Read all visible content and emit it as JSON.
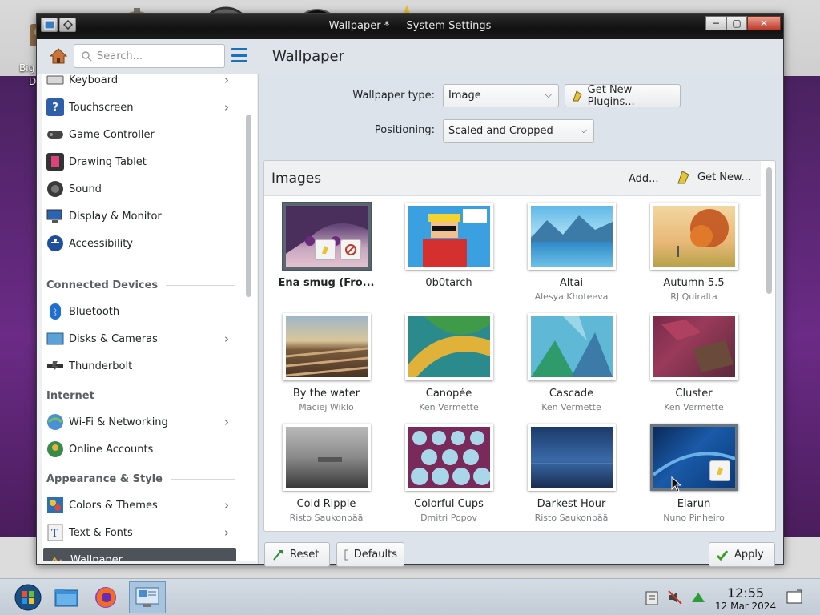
{
  "desktop": {
    "icon_label_1": "Big",
    "icon_label_2": "D"
  },
  "window": {
    "title": "Wallpaper * — System Settings",
    "controls": {
      "minimize": "−",
      "maximize": "▢",
      "close": "✕"
    }
  },
  "toolbar": {
    "search_placeholder": "Search...",
    "page_title": "Wallpaper"
  },
  "sidebar": {
    "items": [
      {
        "label": "Keyboard",
        "icon": "keyboard-icon",
        "chevron": true
      },
      {
        "label": "Touchscreen",
        "icon": "touchscreen-icon",
        "chevron": true
      },
      {
        "label": "Game Controller",
        "icon": "game-controller-icon",
        "chevron": false
      },
      {
        "label": "Drawing Tablet",
        "icon": "drawing-tablet-icon",
        "chevron": false
      },
      {
        "label": "Sound",
        "icon": "sound-icon",
        "chevron": false
      },
      {
        "label": "Display & Monitor",
        "icon": "display-icon",
        "chevron": false
      },
      {
        "label": "Accessibility",
        "icon": "accessibility-icon",
        "chevron": false
      }
    ],
    "section_connected": "Connected Devices",
    "connected_items": [
      {
        "label": "Bluetooth",
        "icon": "bluetooth-icon",
        "chevron": false
      },
      {
        "label": "Disks & Cameras",
        "icon": "disks-icon",
        "chevron": true
      },
      {
        "label": "Thunderbolt",
        "icon": "thunderbolt-icon",
        "chevron": false
      }
    ],
    "section_internet": "Internet",
    "internet_items": [
      {
        "label": "Wi-Fi & Networking",
        "icon": "network-icon",
        "chevron": true
      },
      {
        "label": "Online Accounts",
        "icon": "online-accounts-icon",
        "chevron": false
      }
    ],
    "section_appearance": "Appearance & Style",
    "appearance_items": [
      {
        "label": "Colors & Themes",
        "icon": "colors-icon",
        "chevron": true
      },
      {
        "label": "Text & Fonts",
        "icon": "fonts-icon",
        "chevron": true
      },
      {
        "label": "Wallpaper",
        "icon": "wallpaper-icon",
        "chevron": false,
        "active": true
      }
    ]
  },
  "form": {
    "wallpaper_type_label": "Wallpaper type:",
    "wallpaper_type_value": "Image",
    "get_plugins_label": "Get New Plugins...",
    "positioning_label": "Positioning:",
    "positioning_value": "Scaled and Cropped"
  },
  "images": {
    "title": "Images",
    "add_label": "Add...",
    "get_new_label": "Get New...",
    "tiles": [
      {
        "name": "Ena smug (Fro...",
        "author": "",
        "selected": true
      },
      {
        "name": "0b0tarch",
        "author": ""
      },
      {
        "name": "Altai",
        "author": "Alesya Khoteeva"
      },
      {
        "name": "Autumn 5.5",
        "author": "RJ Quiralta"
      },
      {
        "name": "By the water",
        "author": "Maciej Wiklo"
      },
      {
        "name": "Canopée",
        "author": "Ken Vermette"
      },
      {
        "name": "Cascade",
        "author": "Ken Vermette"
      },
      {
        "name": "Cluster",
        "author": "Ken Vermette"
      },
      {
        "name": "Cold Ripple",
        "author": "Risto Saukonpää"
      },
      {
        "name": "Colorful Cups",
        "author": "Dmitri Popov"
      },
      {
        "name": "Darkest Hour",
        "author": "Risto Saukonpää"
      },
      {
        "name": "Elarun",
        "author": "Nuno Pinheiro"
      }
    ]
  },
  "footer": {
    "reset_label": "Reset",
    "defaults_label": "Defaults",
    "apply_label": "Apply"
  },
  "taskbar": {
    "time": "12:55",
    "date": "12 Mar 2024"
  }
}
